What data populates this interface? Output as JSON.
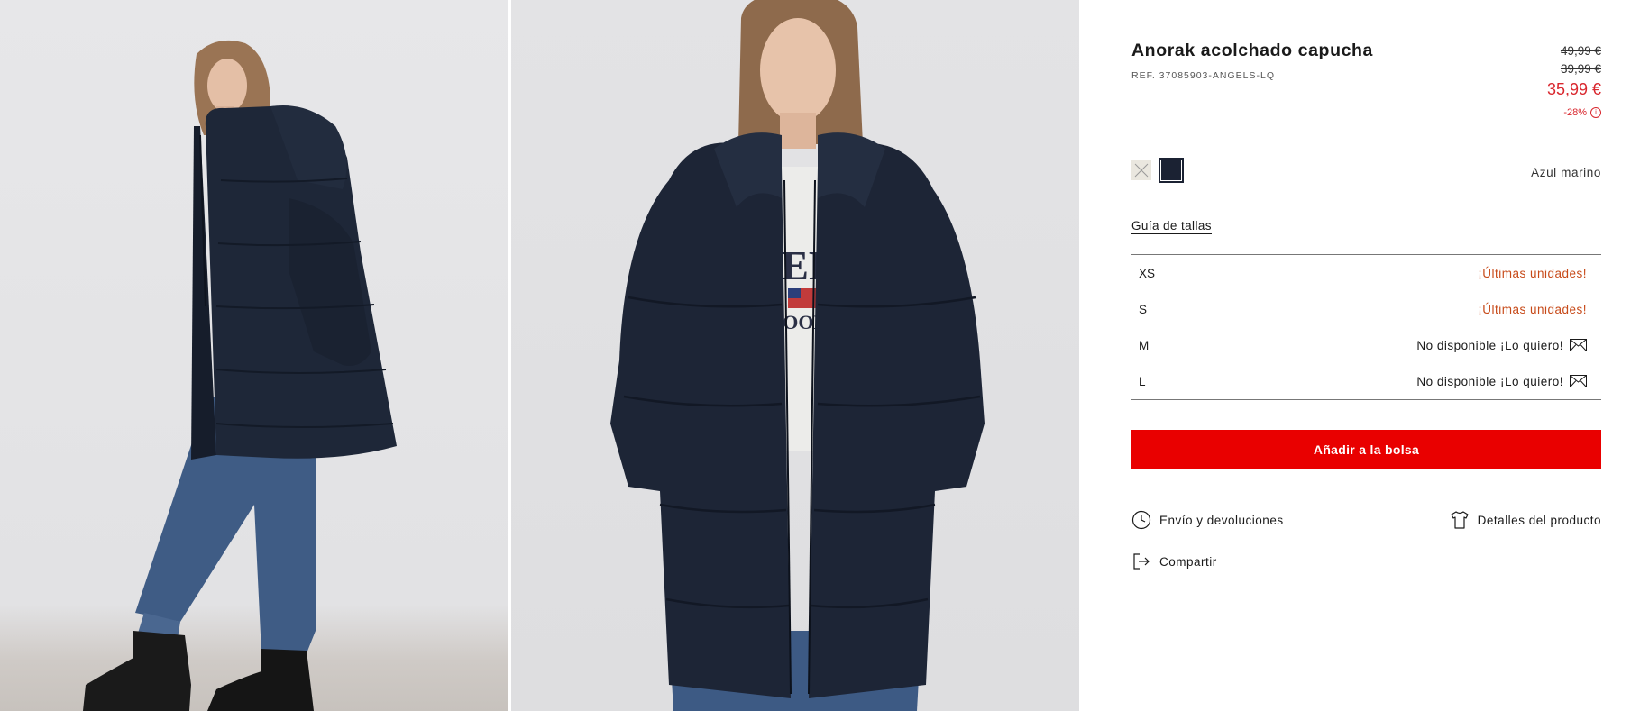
{
  "gallery": {
    "images": [
      {
        "name": "product-photo-side"
      },
      {
        "name": "product-photo-front",
        "tee_text_1": "VERSI",
        "tee_text_2": "E GOOD T"
      }
    ]
  },
  "product": {
    "title": "Anorak acolchado capucha",
    "ref": "REF. 37085903-ANGELS-LQ",
    "price_original": "49,99 €",
    "price_previous": "39,99 €",
    "price_current": "35,99 €",
    "discount": "-28%",
    "info_glyph": "i"
  },
  "colors": {
    "options": [
      {
        "name": "cream",
        "hex": "#eae7df",
        "selected": false
      },
      {
        "name": "navy",
        "hex": "#1b2233",
        "selected": true
      }
    ],
    "selected_label": "Azul marino"
  },
  "size_guide_label": "Guía de tallas",
  "sizes": [
    {
      "label": "XS",
      "status": "¡Últimas unidades!",
      "available": true
    },
    {
      "label": "S",
      "status": "¡Últimas unidades!",
      "available": true
    },
    {
      "label": "M",
      "status": "No disponible ¡Lo quiero!",
      "available": false
    },
    {
      "label": "L",
      "status": "No disponible ¡Lo quiero!",
      "available": false
    }
  ],
  "add_to_bag_label": "Añadir a la bolsa",
  "links": {
    "shipping": "Envío y devoluciones",
    "details": "Detalles del producto",
    "share": "Compartir"
  },
  "theme": {
    "accent_red": "#e90000",
    "price_red": "#d9272e",
    "last_units_orange": "#c74a19"
  }
}
